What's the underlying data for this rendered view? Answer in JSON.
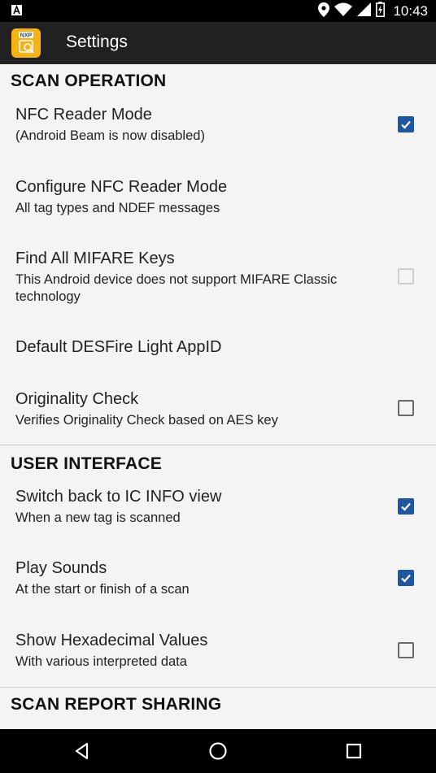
{
  "status_bar": {
    "time": "10:43",
    "notification_icon": "a-icon",
    "icons": [
      "location-icon",
      "wifi-icon",
      "signal-icon",
      "battery-icon"
    ]
  },
  "app_bar": {
    "title": "Settings",
    "icon": "nxp-app-icon",
    "icon_color": "#f5b318"
  },
  "sections": {
    "scan_operation": {
      "header": "SCAN OPERATION",
      "items": [
        {
          "title": "NFC Reader Mode",
          "summary": "(Android Beam is now disabled)",
          "checkbox": "checked"
        },
        {
          "title": "Configure NFC Reader Mode",
          "summary": "All tag types and NDEF messages"
        },
        {
          "title": "Find All MIFARE Keys",
          "summary": "This Android device does not support MIFARE Classic technology",
          "checkbox": "disabled"
        },
        {
          "title": "Default DESFire Light AppID"
        },
        {
          "title": "Originality Check",
          "summary": "Verifies Originality Check based on AES key",
          "checkbox": "unchecked"
        }
      ]
    },
    "user_interface": {
      "header": "USER INTERFACE",
      "items": [
        {
          "title": "Switch back to IC INFO view",
          "summary": "When a new tag is scanned",
          "checkbox": "checked"
        },
        {
          "title": "Play Sounds",
          "summary": "At the start or finish of a scan",
          "checkbox": "checked"
        },
        {
          "title": "Show Hexadecimal Values",
          "summary": "With various interpreted data",
          "checkbox": "unchecked"
        }
      ]
    },
    "scan_report_sharing": {
      "header": "SCAN REPORT SHARING"
    }
  },
  "nav_bar": {
    "buttons": [
      "back-icon",
      "home-icon",
      "recents-icon"
    ]
  },
  "colors": {
    "accent": "#1e56a0",
    "app_bar": "#212121",
    "background": "#f4f4f4"
  }
}
